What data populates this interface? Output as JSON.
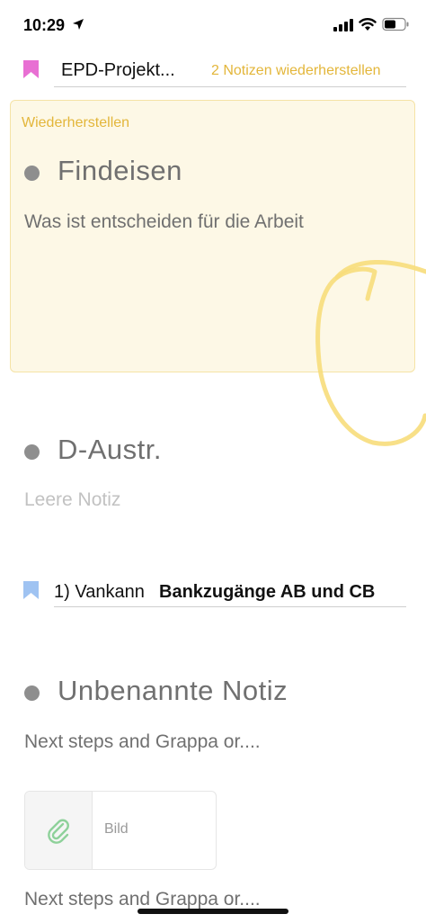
{
  "status_bar": {
    "time": "10:29"
  },
  "section1": {
    "title": "EPD-Projekt...",
    "restore_link": "2 Notizen wiederherstellen",
    "bookmark_color": "#e86fd3"
  },
  "restore_card": {
    "label": "Wiederherstellen",
    "note_title": "Findeisen",
    "note_body": "Was ist entscheiden für die Arbeit"
  },
  "note2": {
    "title": "D-Austr.",
    "body": "Leere Notiz"
  },
  "section2": {
    "prefix": "1) Vankann",
    "title": "Bankzugänge AB und CB",
    "bookmark_color": "#9fc3f2"
  },
  "note3": {
    "title": "Unbenannte Notiz",
    "body": "Next steps and Grappa or....",
    "body_repeat": "Next steps and Grappa or...."
  },
  "attachment": {
    "label": "Bild",
    "icon": "paperclip-icon"
  },
  "colors": {
    "accent_yellow": "#e3b63a",
    "card_background": "#fdf8e6",
    "bullet": "#8e8e8e"
  }
}
